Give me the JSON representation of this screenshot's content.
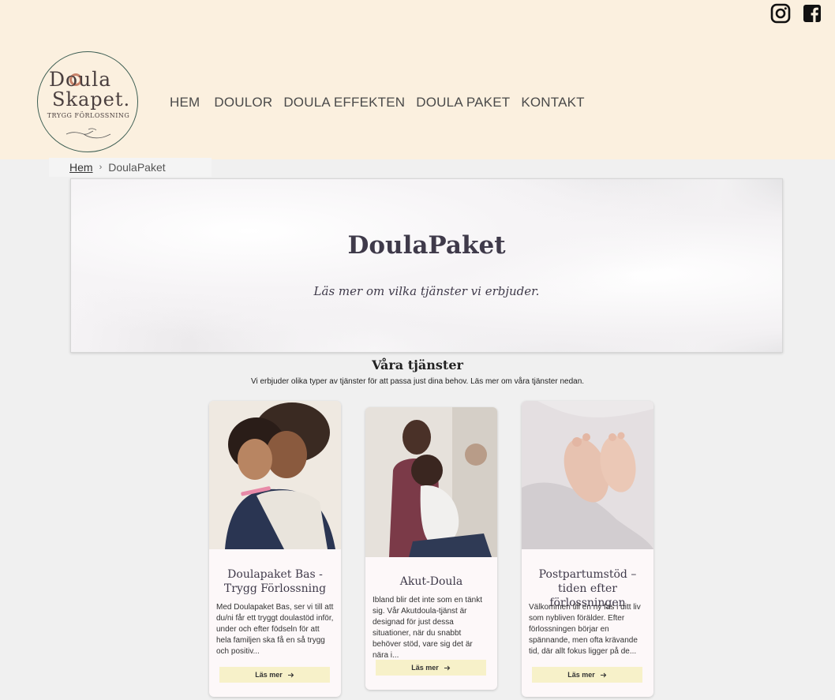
{
  "header": {
    "logo": {
      "line1": "Doula",
      "line2": "Skapet.",
      "tagline": "TRYGG FÖRLOSSNING"
    },
    "nav": [
      {
        "label": "HEM"
      },
      {
        "label": "DOULOR"
      },
      {
        "label": "DOULA EFFEKTEN"
      },
      {
        "label": "DOULA PAKET"
      },
      {
        "label": "KONTAKT"
      }
    ],
    "social": [
      {
        "icon": "instagram-icon"
      },
      {
        "icon": "facebook-icon"
      }
    ]
  },
  "breadcrumb": {
    "home": "Hem",
    "separator": "›",
    "current": "DoulaPaket"
  },
  "hero": {
    "title": "DoulaPaket",
    "subtitle": "Läs mer om vilka tjänster vi erbjuder."
  },
  "services": {
    "title": "Våra tjänster",
    "subtitle": "Vi erbjuder olika typer av tjänster för att passa just dina behov. Läs mer om våra tjänster nedan."
  },
  "cards": [
    {
      "title": "Doulapaket Bas - Trygg Förlossning",
      "text": "Med Doulapaket Bas, ser vi till att du/ni får ett tryggt doulastöd inför, under och efter födseln för att hela familjen ska få en så trygg och positiv...",
      "button": "Läs mer"
    },
    {
      "title": "Akut-Doula",
      "text": "Ibland blir det inte som en tänkt sig. Vår Akutdoula-tjänst är designad för just dessa situationer, när du snabbt behöver stöd, vare sig det är nära i...",
      "button": "Läs mer"
    },
    {
      "title": "Postpartumstöd – tiden efter förlossningen",
      "text": "Välkommen till en ny fas i ditt liv som nybliven förälder. Efter förlossningen börjar en spännande, men ofta krävande tid, där allt fokus ligger på de...",
      "button": "Läs mer"
    }
  ],
  "colors": {
    "header_bg": "#fbf0df",
    "page_bg": "#f0f0f0",
    "button_bg": "#f7f1c9",
    "heading": "#3f3a4a"
  }
}
